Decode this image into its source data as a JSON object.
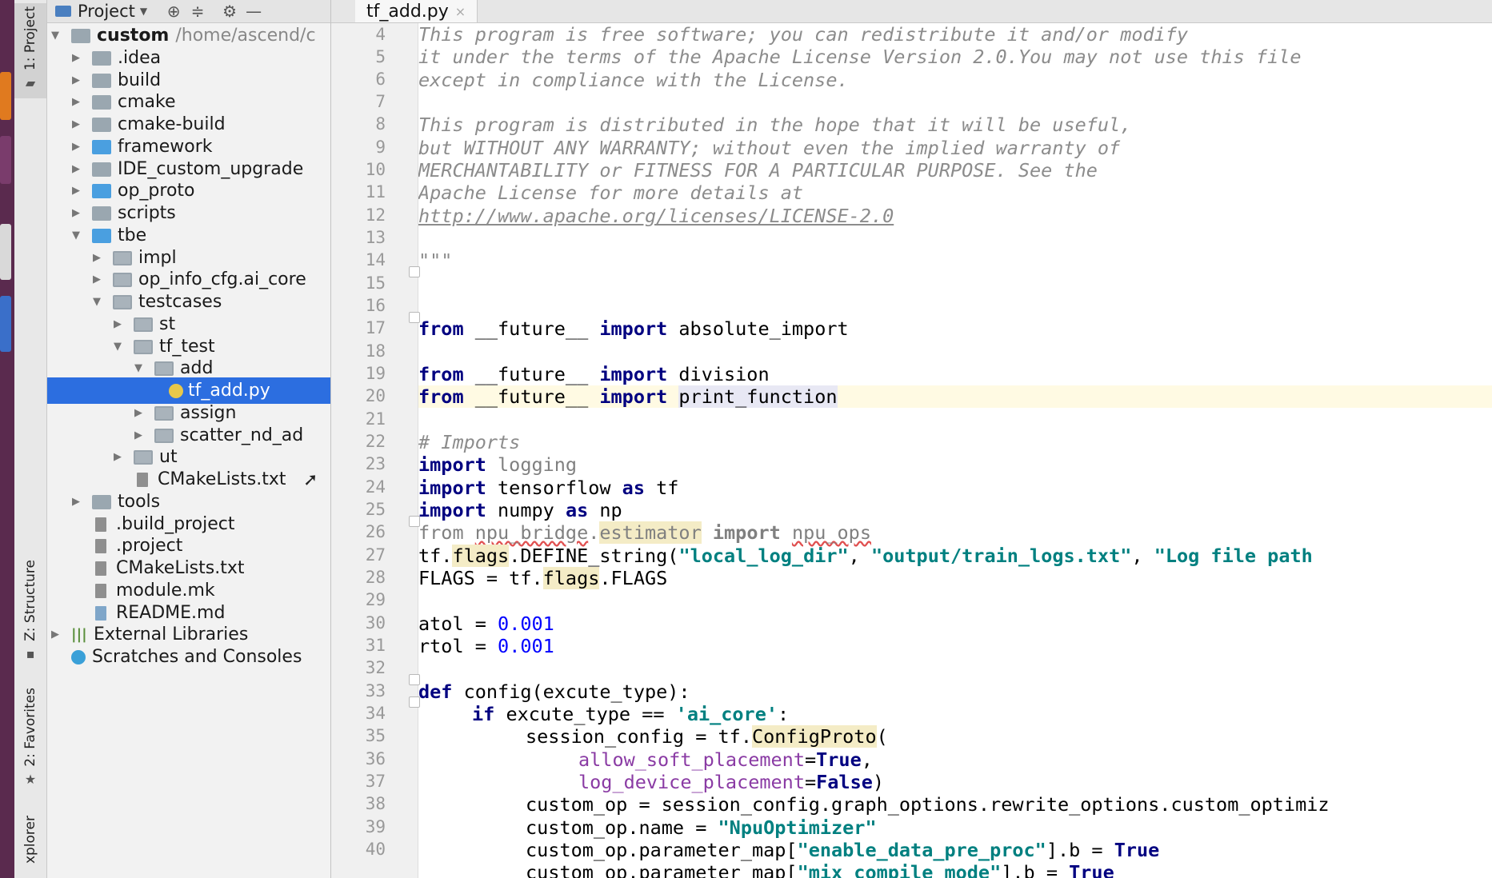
{
  "project_panel": {
    "title": "Project",
    "tree": [
      {
        "label": "custom",
        "path": "/home/ascend/c",
        "bold": true
      },
      {
        "label": ".idea"
      },
      {
        "label": "build"
      },
      {
        "label": "cmake"
      },
      {
        "label": "cmake-build"
      },
      {
        "label": "framework"
      },
      {
        "label": "IDE_custom_upgrade"
      },
      {
        "label": "op_proto"
      },
      {
        "label": "scripts"
      },
      {
        "label": "tbe"
      },
      {
        "label": "impl"
      },
      {
        "label": "op_info_cfg.ai_core"
      },
      {
        "label": "testcases"
      },
      {
        "label": "st"
      },
      {
        "label": "tf_test"
      },
      {
        "label": "add"
      },
      {
        "label": "tf_add.py"
      },
      {
        "label": "assign"
      },
      {
        "label": "scatter_nd_ad"
      },
      {
        "label": "ut"
      },
      {
        "label": "CMakeLists.txt"
      },
      {
        "label": "tools"
      },
      {
        "label": ".build_project"
      },
      {
        "label": ".project"
      },
      {
        "label": "CMakeLists.txt"
      },
      {
        "label": "module.mk"
      },
      {
        "label": "README.md"
      },
      {
        "label": "External Libraries"
      },
      {
        "label": "Scratches and Consoles"
      }
    ]
  },
  "tool_window_tabs": {
    "project": "1: Project",
    "structure": "Z: Structure",
    "favorites": "2: Favorites",
    "explorer": "xplorer"
  },
  "editor": {
    "active_tab": "tf_add.py",
    "tab_close": "×",
    "line_numbers": [
      "4",
      "5",
      "6",
      "7",
      "8",
      "9",
      "10",
      "11",
      "12",
      "13",
      "14",
      "15",
      "16",
      "17",
      "18",
      "19",
      "20",
      "21",
      "22",
      "23",
      "24",
      "25",
      "26",
      "27",
      "28",
      "29",
      "30",
      "31",
      "32",
      "33",
      "34",
      "35",
      "36",
      "37",
      "38",
      "39",
      "40"
    ],
    "lines": {
      "l4": "This program is free software; you can redistribute it and/or modify",
      "l5": "it under the terms of the Apache License Version 2.0.You may not use this file",
      "l6": "except in compliance with the License.",
      "l8": "This program is distributed in the hope that it will be useful,",
      "l9": "but WITHOUT ANY WARRANTY; without even the implied warranty of",
      "l10": "MERCHANTABILITY or FITNESS FOR A PARTICULAR PURPOSE. See the",
      "l11": "Apache License for more details at",
      "l12": "http://www.apache.org/licenses/LICENSE-2.0",
      "l14": "\"\"\"",
      "kw_from": "from",
      "kw_import": "import",
      "future": " __future__ ",
      "abs": " absolute_import",
      "div": " division",
      "pf": "print_function",
      "l21": "# Imports",
      "logging": " logging",
      "tensorflow": " tensorflow ",
      "kw_as": "as",
      "tf": " tf",
      "numpy": " numpy ",
      "np": " np",
      "npu_bridge": "npu_bridge",
      "dot": ".",
      "estimator": "estimator",
      "npu_ops": "npu_ops",
      "tf_dot": "tf.",
      "flags": "flags",
      "define_string": ".DEFINE_string(",
      "s_local": "\"local_log_dir\"",
      "comma": ", ",
      "s_output": "\"output/train_logs.txt\"",
      "s_log": "\"Log file path",
      "flags_eq": "FLAGS = tf.",
      "flags_end": ".FLAGS",
      "atol": "atol = ",
      "rtol": "rtol = ",
      "n001": "0.001",
      "kw_def": "def",
      "config_sig": " config(excute_type):",
      "kw_if": "if",
      "if_cond": " excute_type == ",
      "s_aicore": "'ai_core'",
      "colon": ":",
      "sc_assign": "session_config = tf.",
      "configproto": "ConfigProto",
      "paren": "(",
      "allow_soft": "allow_soft_placement",
      "eq": "=",
      "kw_true": "True",
      "kw_false": "False",
      "log_device": "log_device_placement",
      "close_paren": ")",
      "l37": "custom_op = session_config.graph_options.rewrite_options.custom_optimiz",
      "l38a": "custom_op.name = ",
      "s_npuopt": "\"NpuOptimizer\"",
      "pm": "custom_op.parameter_map[",
      "s_edpp": "\"enable_data_pre_proc\"",
      "s_mcm": "\"mix_compile_mode\"",
      "b_eq": "].b = "
    }
  }
}
